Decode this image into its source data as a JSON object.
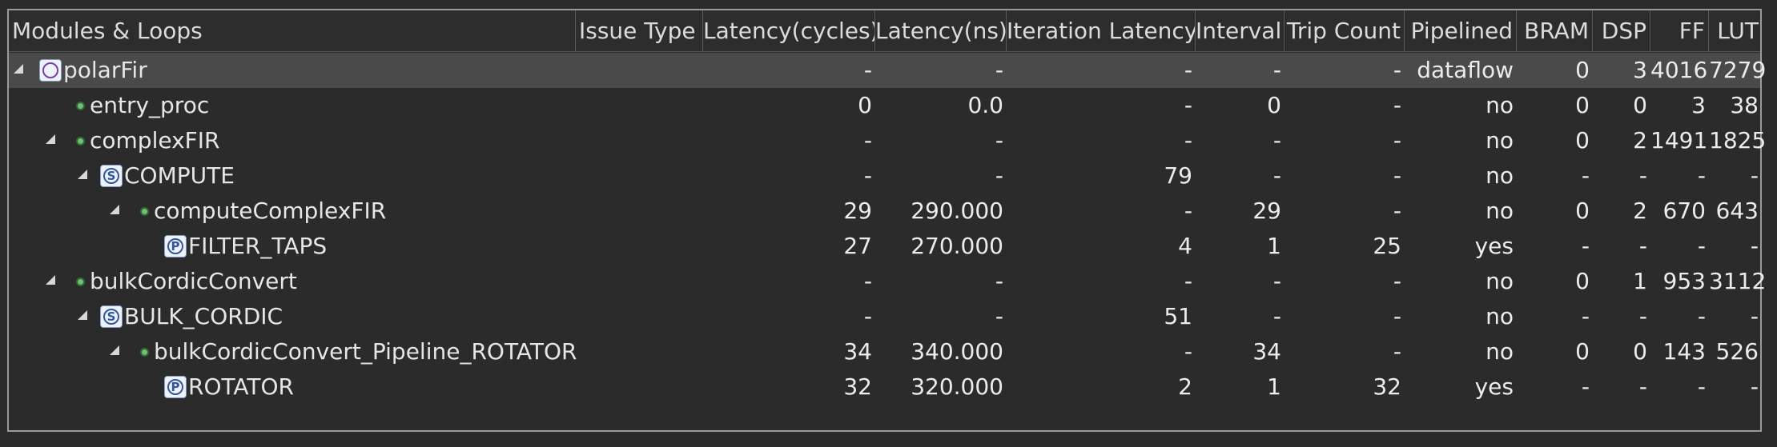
{
  "columns": {
    "modules": "Modules & Loops",
    "issue": "Issue Type",
    "lat_cycles": "Latency(cycles)",
    "lat_ns": "Latency(ns)",
    "iter_lat": "Iteration Latency",
    "interval": "Interval",
    "trip": "Trip Count",
    "pipelined": "Pipelined",
    "bram": "BRAM",
    "dsp": "DSP",
    "ff": "FF",
    "lut": "LUT"
  },
  "icons": {
    "top": "top-function-icon",
    "function": "function-dot-icon",
    "sequential": "sequential-loop-icon",
    "pipelined": "pipelined-loop-icon",
    "expand": "expand-triangle-icon"
  },
  "rows": [
    {
      "name": "polarFir",
      "issue": "",
      "lat_cycles": "-",
      "lat_ns": "-",
      "iter_lat": "-",
      "interval": "-",
      "trip": "-",
      "pipelined": "dataflow",
      "bram": "0",
      "dsp": "3",
      "ff": "4016",
      "lut": "7279"
    },
    {
      "name": "entry_proc",
      "issue": "",
      "lat_cycles": "0",
      "lat_ns": "0.0",
      "iter_lat": "-",
      "interval": "0",
      "trip": "-",
      "pipelined": "no",
      "bram": "0",
      "dsp": "0",
      "ff": "3",
      "lut": "38"
    },
    {
      "name": "complexFIR",
      "issue": "",
      "lat_cycles": "-",
      "lat_ns": "-",
      "iter_lat": "-",
      "interval": "-",
      "trip": "-",
      "pipelined": "no",
      "bram": "0",
      "dsp": "2",
      "ff": "1491",
      "lut": "1825"
    },
    {
      "name": "COMPUTE",
      "issue": "",
      "lat_cycles": "-",
      "lat_ns": "-",
      "iter_lat": "79",
      "interval": "-",
      "trip": "-",
      "pipelined": "no",
      "bram": "-",
      "dsp": "-",
      "ff": "-",
      "lut": "-"
    },
    {
      "name": "computeComplexFIR",
      "issue": "",
      "lat_cycles": "29",
      "lat_ns": "290.000",
      "iter_lat": "-",
      "interval": "29",
      "trip": "-",
      "pipelined": "no",
      "bram": "0",
      "dsp": "2",
      "ff": "670",
      "lut": "643"
    },
    {
      "name": "FILTER_TAPS",
      "issue": "",
      "lat_cycles": "27",
      "lat_ns": "270.000",
      "iter_lat": "4",
      "interval": "1",
      "trip": "25",
      "pipelined": "yes",
      "bram": "-",
      "dsp": "-",
      "ff": "-",
      "lut": "-"
    },
    {
      "name": "bulkCordicConvert",
      "issue": "",
      "lat_cycles": "-",
      "lat_ns": "-",
      "iter_lat": "-",
      "interval": "-",
      "trip": "-",
      "pipelined": "no",
      "bram": "0",
      "dsp": "1",
      "ff": "953",
      "lut": "3112"
    },
    {
      "name": "BULK_CORDIC",
      "issue": "",
      "lat_cycles": "-",
      "lat_ns": "-",
      "iter_lat": "51",
      "interval": "-",
      "trip": "-",
      "pipelined": "no",
      "bram": "-",
      "dsp": "-",
      "ff": "-",
      "lut": "-"
    },
    {
      "name": "bulkCordicConvert_Pipeline_ROTATOR",
      "issue": "",
      "lat_cycles": "34",
      "lat_ns": "340.000",
      "iter_lat": "-",
      "interval": "34",
      "trip": "-",
      "pipelined": "no",
      "bram": "0",
      "dsp": "0",
      "ff": "143",
      "lut": "526"
    },
    {
      "name": "ROTATOR",
      "issue": "",
      "lat_cycles": "32",
      "lat_ns": "320.000",
      "iter_lat": "2",
      "interval": "1",
      "trip": "32",
      "pipelined": "yes",
      "bram": "-",
      "dsp": "-",
      "ff": "-",
      "lut": "-"
    }
  ],
  "badges": {
    "sequential_letter": "S",
    "pipelined_letter": "P"
  }
}
